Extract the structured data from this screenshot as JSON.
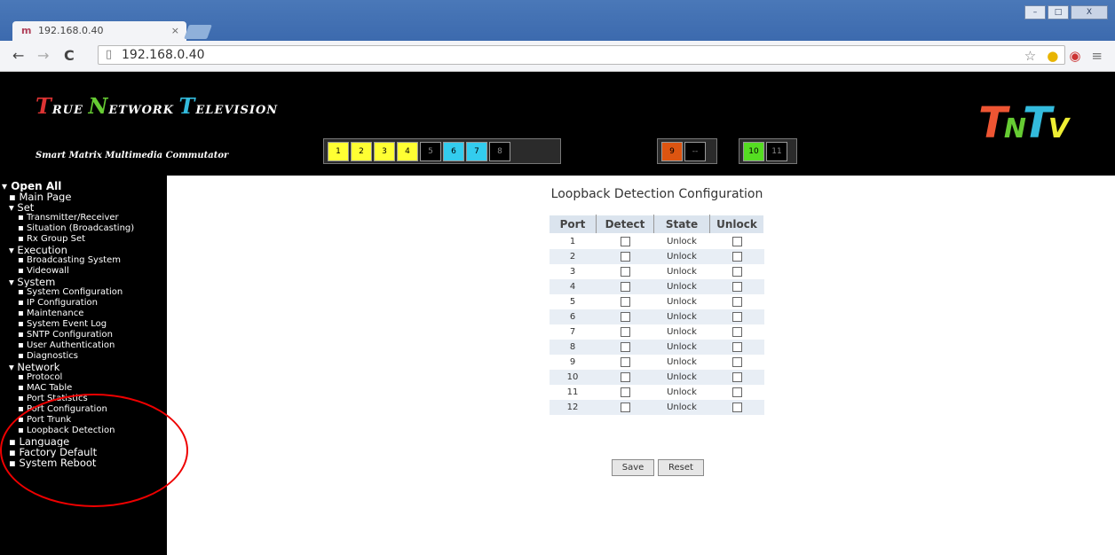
{
  "browser": {
    "tab_title": "192.168.0.40",
    "tab_close": "×",
    "address": "192.168.0.40",
    "nav": {
      "back": "←",
      "forward": "→",
      "reload": "C"
    },
    "window_controls": {
      "minimize": "–",
      "maximize": "□",
      "close": "X"
    },
    "toolbar_icons": [
      "star-icon",
      "extension-icon",
      "chrome-icon",
      "menu-icon"
    ]
  },
  "header": {
    "logo": {
      "w1_initial": "T",
      "w1_rest": "RUE",
      "w2_initial": "N",
      "w2_rest": "ETWORK",
      "w3_initial": "T",
      "w3_rest": "ELEVISION"
    },
    "tagline": "Smart Matrix Multimedia Commutator",
    "brand": {
      "t1": "T",
      "n": "N",
      "t2": "T",
      "v": "V"
    },
    "channels_group1": [
      {
        "label": "1",
        "color": "#ffff33"
      },
      {
        "label": "2",
        "color": "#ffff33"
      },
      {
        "label": "3",
        "color": "#ffff33"
      },
      {
        "label": "4",
        "color": "#ffff33"
      },
      {
        "label": "5",
        "color": "#000000"
      },
      {
        "label": "6",
        "color": "#33ccee"
      },
      {
        "label": "7",
        "color": "#33ccee"
      },
      {
        "label": "8",
        "color": "#000000"
      }
    ],
    "channels_group2": [
      {
        "label": "9",
        "color": "#dd5511"
      },
      {
        "label": "--",
        "color": "#000000"
      }
    ],
    "channels_group3": [
      {
        "label": "10",
        "color": "#55dd22"
      },
      {
        "label": "11",
        "color": "#000000"
      }
    ]
  },
  "sidebar": {
    "items": [
      {
        "level": 0,
        "label": "▾ Open All"
      },
      {
        "level": 1,
        "label": "▪ Main Page"
      },
      {
        "level": 1,
        "label": "▾ Set"
      },
      {
        "level": 2,
        "label": "▪ Transmitter/Receiver"
      },
      {
        "level": 2,
        "label": "▪ Situation (Broadcasting)"
      },
      {
        "level": 2,
        "label": "▪ Rx Group Set"
      },
      {
        "level": 1,
        "label": "▾ Execution"
      },
      {
        "level": 2,
        "label": "▪ Broadcasting System"
      },
      {
        "level": 2,
        "label": "▪ Videowall"
      },
      {
        "level": 1,
        "label": "▾ System"
      },
      {
        "level": 2,
        "label": "▪ System Configuration"
      },
      {
        "level": 2,
        "label": "▪ IP Configuration"
      },
      {
        "level": 2,
        "label": "▪ Maintenance"
      },
      {
        "level": 2,
        "label": "▪ System Event Log"
      },
      {
        "level": 2,
        "label": "▪ SNTP Configuration"
      },
      {
        "level": 2,
        "label": "▪ User Authentication"
      },
      {
        "level": 2,
        "label": "▪ Diagnostics"
      },
      {
        "level": 1,
        "label": "▾ Network"
      },
      {
        "level": 2,
        "label": "▪ Protocol"
      },
      {
        "level": 2,
        "label": "▪ MAC Table"
      },
      {
        "level": 2,
        "label": "▪ Port Statistics"
      },
      {
        "level": 2,
        "label": "▪ Port Configuration"
      },
      {
        "level": 2,
        "label": "▪ Port Trunk"
      },
      {
        "level": 2,
        "label": "▪ Loopback Detection"
      },
      {
        "level": 1,
        "label": "▪ Language"
      },
      {
        "level": 1,
        "label": "▪ Factory Default"
      },
      {
        "level": 1,
        "label": "▪ System Reboot"
      }
    ]
  },
  "main": {
    "title": "Loopback Detection Configuration",
    "columns": [
      "Port",
      "Detect",
      "State",
      "Unlock"
    ],
    "rows": [
      {
        "port": "1",
        "state": "Unlock"
      },
      {
        "port": "2",
        "state": "Unlock"
      },
      {
        "port": "3",
        "state": "Unlock"
      },
      {
        "port": "4",
        "state": "Unlock"
      },
      {
        "port": "5",
        "state": "Unlock"
      },
      {
        "port": "6",
        "state": "Unlock"
      },
      {
        "port": "7",
        "state": "Unlock"
      },
      {
        "port": "8",
        "state": "Unlock"
      },
      {
        "port": "9",
        "state": "Unlock"
      },
      {
        "port": "10",
        "state": "Unlock"
      },
      {
        "port": "11",
        "state": "Unlock"
      },
      {
        "port": "12",
        "state": "Unlock"
      }
    ],
    "save_label": "Save",
    "reset_label": "Reset"
  },
  "colors": {
    "annotation": "#e00000",
    "header_bg": "#dbe4ee",
    "row_alt": "#e8eef5"
  }
}
